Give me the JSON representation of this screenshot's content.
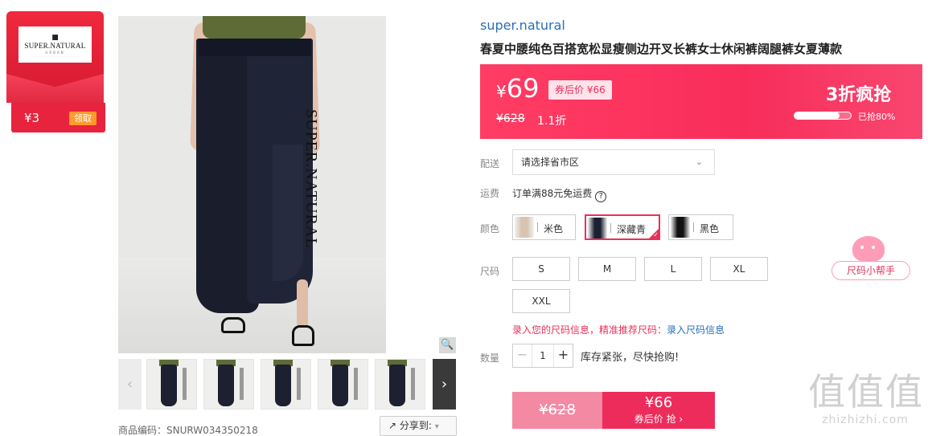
{
  "coupon": {
    "logo_text": "SUPER.NATURAL",
    "logo_sub": "URBAN",
    "amount": "¥3",
    "get_label": "领取"
  },
  "gallery": {
    "vertical_brand": "SUPER.NATURAL",
    "sku_code": "商品编码：SNURW034350218",
    "share_label": "分享到:"
  },
  "product": {
    "brand": "super.natural",
    "title": "春夏中腰纯色百搭宽松显瘦侧边开叉长裤女士休闲裤阔腿裤女夏薄款"
  },
  "price": {
    "yen": "¥",
    "current": "69",
    "after_coupon": "券后价 ¥66",
    "original": "¥628",
    "discount": "1.1折",
    "flash_title": "3折疯抢",
    "sold_progress": 0.8,
    "sold_text": "已抢80%"
  },
  "delivery": {
    "label": "配送",
    "placeholder": "请选择省市区"
  },
  "freight": {
    "label": "运费",
    "text": "订单满88元免运费",
    "help_icon": "question-circle-icon"
  },
  "colors": {
    "label": "颜色",
    "options": [
      {
        "name": "米色",
        "swatch": "#d8c4b0"
      },
      {
        "name": "深藏青",
        "swatch": "#1c2030",
        "selected": true
      },
      {
        "name": "黑色",
        "swatch": "#111111"
      }
    ]
  },
  "sizes": {
    "label": "尺码",
    "options": [
      "S",
      "M",
      "L",
      "XL",
      "XXL"
    ],
    "helper": "尺码小帮手",
    "tip": "录入您的尺码信息，精准推荐尺码：",
    "tip_link": "录入尺码信息"
  },
  "quantity": {
    "label": "数量",
    "minus": "−",
    "value": "1",
    "plus": "+",
    "stock": "库存紧张，尽快抢购!"
  },
  "buy": {
    "original": "¥628",
    "coupon_price": "¥66",
    "coupon_label": "券后价 抢 ›"
  },
  "watermark": {
    "big": "值值值",
    "small": "zhizhizhi.com"
  },
  "colors_theme": {
    "accent": "#f92d5a",
    "link": "#2a6eb8"
  }
}
